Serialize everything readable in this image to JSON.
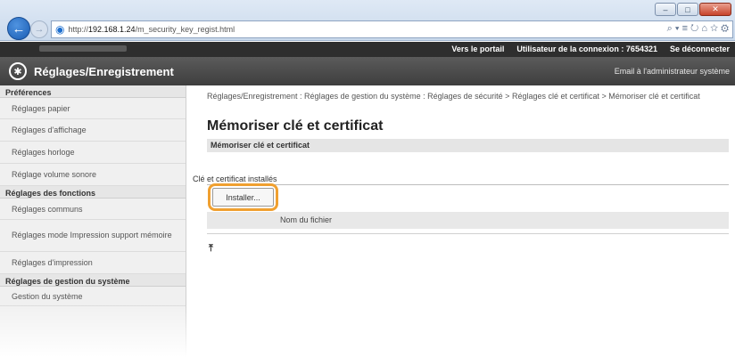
{
  "browser": {
    "url_prefix": "http://",
    "url_host": "192.168.1.24",
    "url_path": "/m_security_key_regist.html",
    "tools": "⌕ ▾ ≡ ↻   ⌂ ☆ ⚙",
    "min": "–",
    "max": "□",
    "close": "✕"
  },
  "topbar": {
    "portal": "Vers le portail",
    "user_label": "Utilisateur de la connexion : 7654321",
    "logout": "Se déconnecter"
  },
  "header": {
    "title": "Réglages/Enregistrement",
    "mail": "Email à l'administrateur système"
  },
  "sidebar": {
    "preferences_head": "Préférences",
    "pref_items": [
      "Réglages papier",
      "Réglages d'affichage",
      "Réglages horloge",
      "Réglage volume sonore"
    ],
    "functions_head": "Réglages des fonctions",
    "func_items": [
      "Réglages communs",
      "Réglages mode Impression support mémoire",
      "Réglages d'impression"
    ],
    "system_head": "Réglages de gestion du système",
    "system_items": [
      "Gestion du système"
    ]
  },
  "main": {
    "breadcrumb": "Réglages/Enregistrement : Réglages de gestion du système : Réglages de sécurité > Réglages clé et certificat > Mémoriser clé et certificat",
    "page_title": "Mémoriser clé et certificat",
    "section_title": "Mémoriser clé et certificat",
    "subsection_title": "Clé et certificat installés",
    "install_label": "Installer...",
    "file_col_label": "Nom du fichier",
    "top_arrow": "⤒"
  },
  "colors": {
    "highlight": "#f0a030",
    "header_bg": "#4a4a4a",
    "topbar_bg": "#2e2e2e"
  }
}
